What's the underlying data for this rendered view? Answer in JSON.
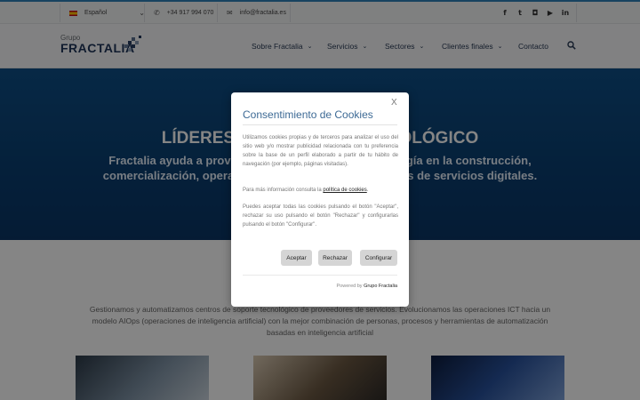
{
  "topbar": {
    "language": "Español",
    "phone": "+34 917 994 070",
    "email": "info@fractalia.es",
    "social": [
      "facebook-icon",
      "twitter-icon",
      "instagram-icon",
      "youtube-icon",
      "linkedin-icon"
    ]
  },
  "header": {
    "logo_small": "Grupo",
    "logo_main": "FRACTALIA",
    "nav": [
      "Sobre Fractalia",
      "Servicios",
      "Sectores",
      "Clientes finales",
      "Contacto"
    ]
  },
  "hero": {
    "title": "LÍDERES EN SERVICIO TECNOLÓGICO",
    "subtitle": "Fractalia ayuda a proveedores de servicios de tecnología en la construcción, comercialización, operación y mejora de sus propuestas de servicios digitales."
  },
  "intro": {
    "text": "Gestionamos y automatizamos centros de soporte tecnológico de proveedores de servicios. Evolucionamos las operaciones ICT hacia un modelo AIOps (operaciones de inteligencia artificial) con la mejor combinación de personas, procesos y herramientas de automatización basadas en inteligencia artificial"
  },
  "modal": {
    "title": "Consentimiento de Cookies",
    "close": "X",
    "p1": "Utilizamos cookies propias y de terceros para analizar el uso del sitio web y/o mostrar publicidad relacionada con tu preferencia sobre la base de un perfil elaborado a partir de tu hábito de navegación (por ejemplo, páginas visitadas).",
    "p2_prefix": "Para más información consulta la ",
    "p2_link": "política de cookies",
    "p2_suffix": ".",
    "p3": "Puedes aceptar todas las cookies pulsando el botón \"Aceptar\", rechazar su uso pulsando el botón \"Rechazar\" y configurarlas pulsando el botón \"Configurar\".",
    "accept": "Aceptar",
    "reject": "Rechazar",
    "configure": "Configurar",
    "powered_prefix": "Powered by ",
    "powered_brand": "Grupo Fractalia"
  },
  "colors": {
    "accent": "#2f80b9",
    "hero_bg": "#0e4e86",
    "brand_navy": "#1f3559",
    "modal_title": "#3d6a95"
  }
}
